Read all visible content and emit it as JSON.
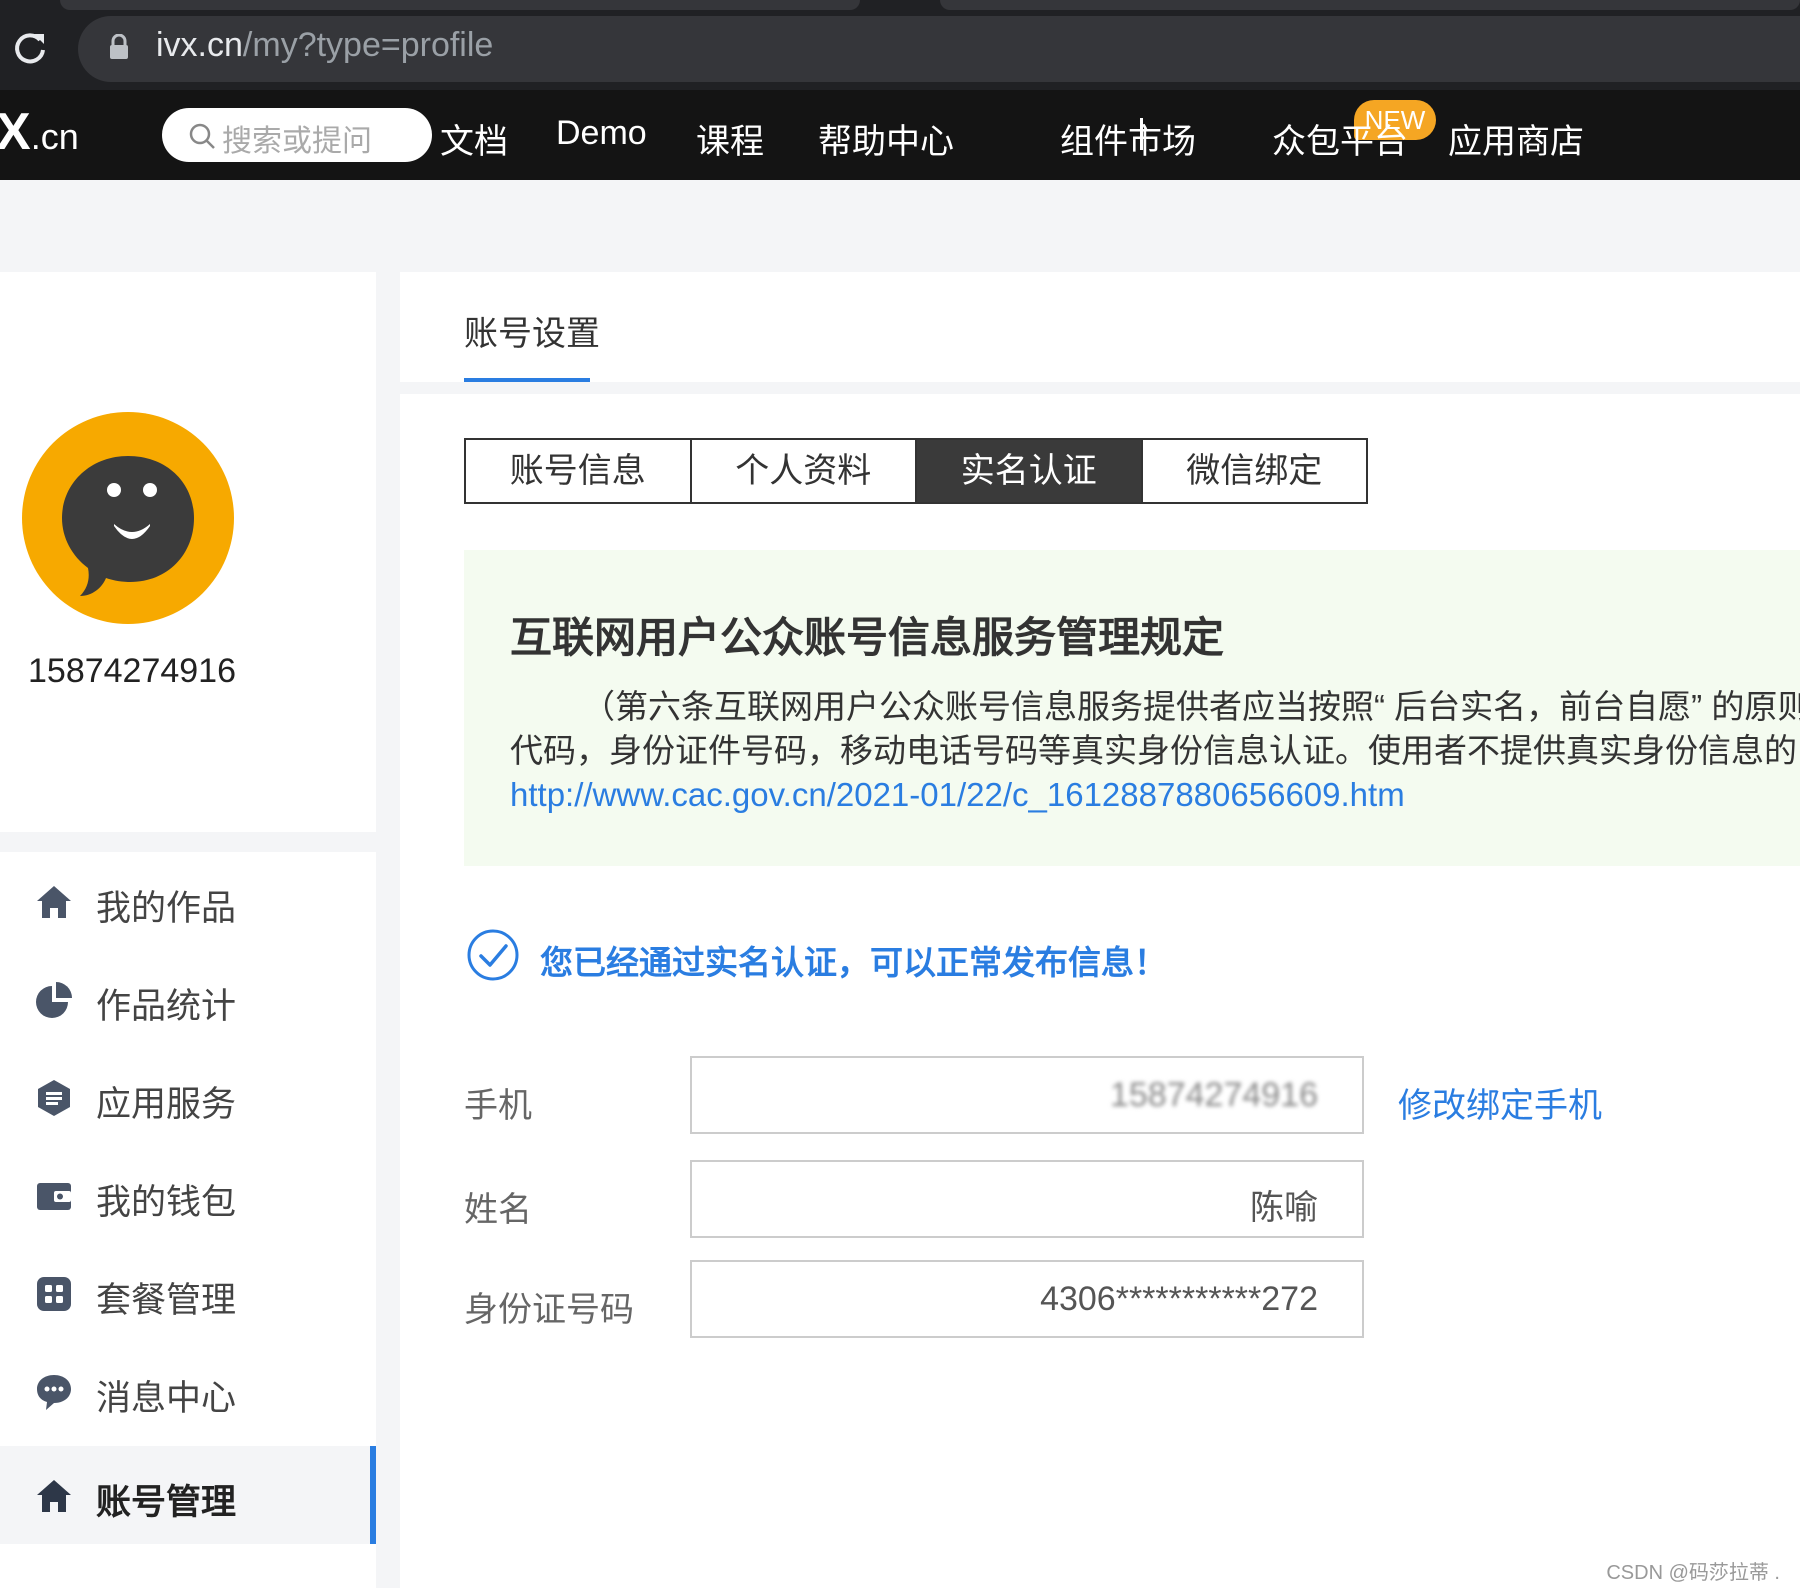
{
  "browser": {
    "url_host": "ivx.cn",
    "url_path": "/my?type=profile"
  },
  "site_nav": {
    "logo_main": "X",
    "logo_suffix": ".cn",
    "search_placeholder": "搜索或提问",
    "items": [
      {
        "label": "文档"
      },
      {
        "label": "Demo"
      },
      {
        "label": "课程"
      },
      {
        "label": "帮助中心"
      },
      {
        "label": "组件市场"
      },
      {
        "label": "众包平台"
      },
      {
        "label": "应用商店"
      }
    ],
    "new_badge": "NEW",
    "colors": {
      "bar": "#141414",
      "badge": "#f5a623"
    }
  },
  "sidebar": {
    "username": "15874274916",
    "menu": [
      {
        "label": "我的作品",
        "icon": "home-icon"
      },
      {
        "label": "作品统计",
        "icon": "pie-chart-icon"
      },
      {
        "label": "应用服务",
        "icon": "service-icon"
      },
      {
        "label": "我的钱包",
        "icon": "wallet-icon"
      },
      {
        "label": "套餐管理",
        "icon": "grid-icon"
      },
      {
        "label": "消息中心",
        "icon": "chat-bubble-icon"
      },
      {
        "label": "账号管理",
        "icon": "home-icon",
        "active": true
      }
    ]
  },
  "main": {
    "title": "账号设置",
    "tabs": [
      {
        "label": "账号信息"
      },
      {
        "label": "个人资料"
      },
      {
        "label": "实名认证",
        "active": true
      },
      {
        "label": "微信绑定"
      }
    ],
    "notice": {
      "title": "互联网用户公众账号信息服务管理规定",
      "line1": "（第六条互联网用户公众账号信息服务提供者应当按照“ 后台实名，前台自愿” 的原则，",
      "line2": "代码，身份证件号码，移动电话号码等真实身份信息认证。使用者不提供真实身份信息的，不",
      "link": "http://www.cac.gov.cn/2021-01/22/c_1612887880656609.htm"
    },
    "verified_text": "您已经通过实名认证，可以正常发布信息！",
    "fields": [
      {
        "label": "手机",
        "value": "15874274916",
        "blurred": true
      },
      {
        "label": "姓名",
        "value": "陈喻"
      },
      {
        "label": "身份证号码",
        "value": "4306***********272"
      }
    ],
    "change_phone_label": "修改绑定手机",
    "accent_color": "#2a7de1"
  },
  "watermark": "CSDN @码莎拉蒂 ."
}
